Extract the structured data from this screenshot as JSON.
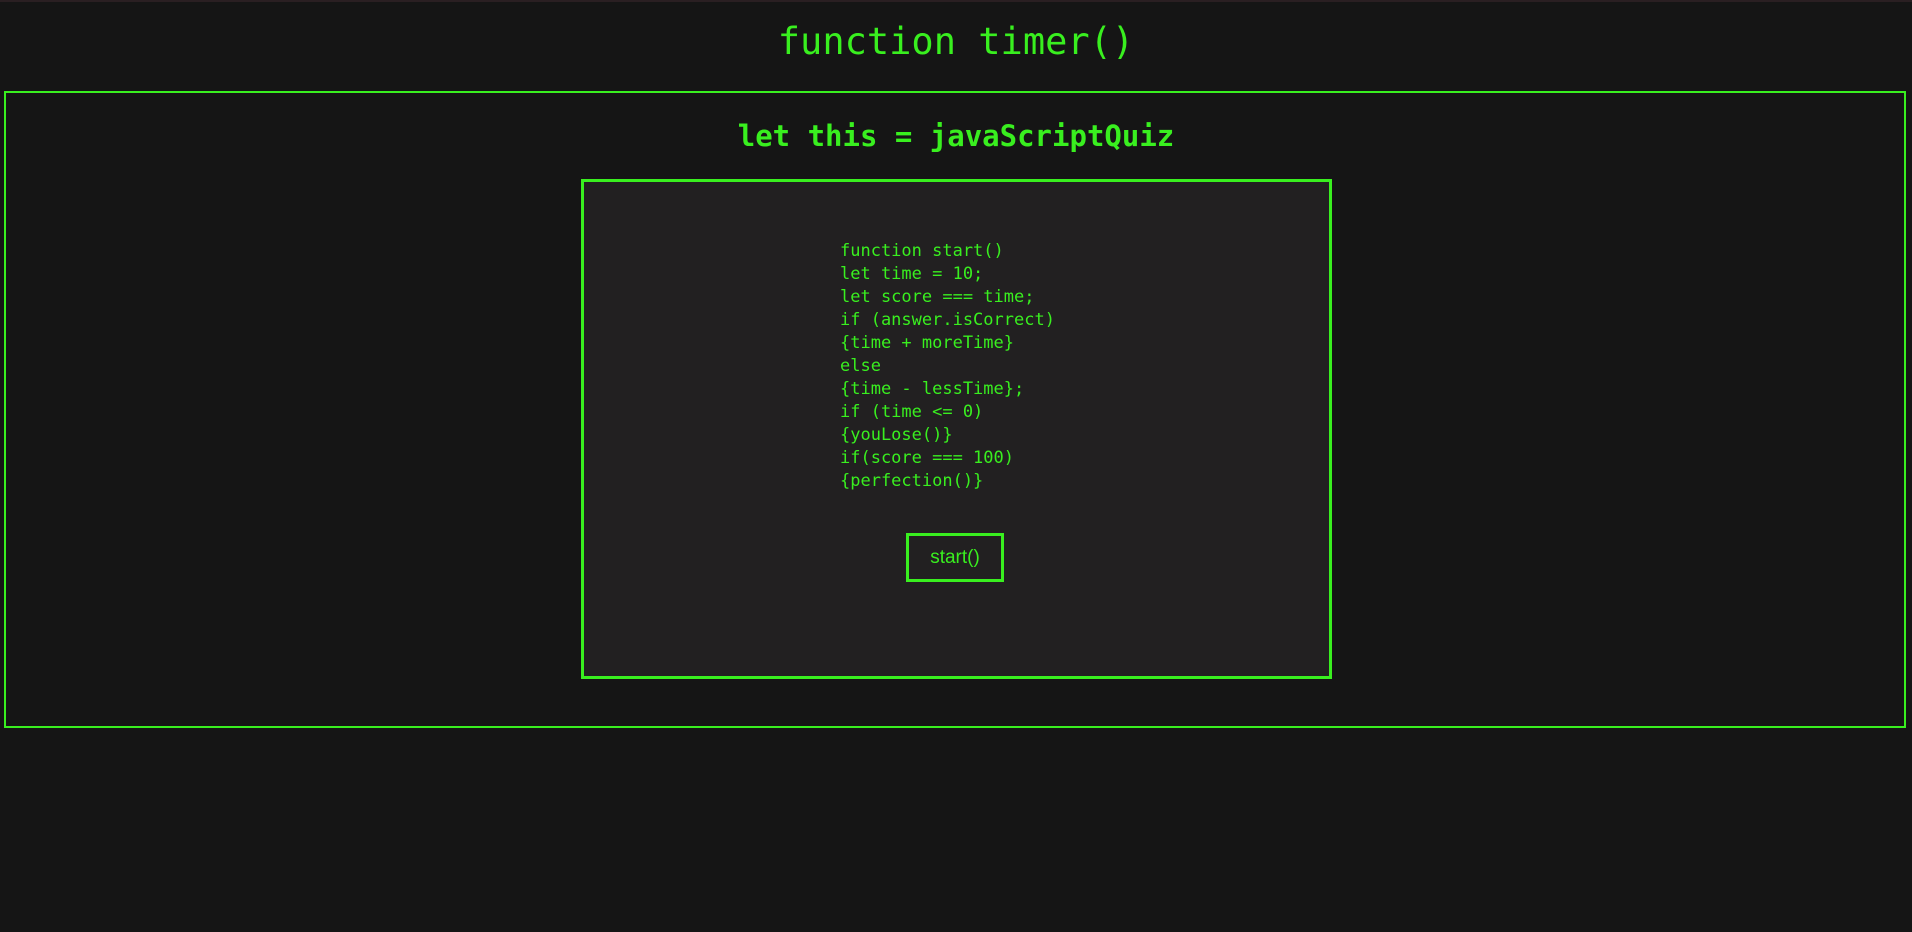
{
  "header": {
    "title": "function timer()"
  },
  "quiz": {
    "title": "let this = javaScriptQuiz",
    "code_lines": [
      "function start()",
      "let time = 10;",
      "let score === time;",
      "if (answer.isCorrect)",
      "{time + moreTime}",
      "else",
      "{time - lessTime};",
      "if (time <= 0)",
      "{youLose()}",
      "if(score === 100)",
      "{perfection()}"
    ],
    "start_label": "start()"
  },
  "colors": {
    "accent": "#39ef1f",
    "background": "#151515",
    "card_background": "#222021"
  }
}
